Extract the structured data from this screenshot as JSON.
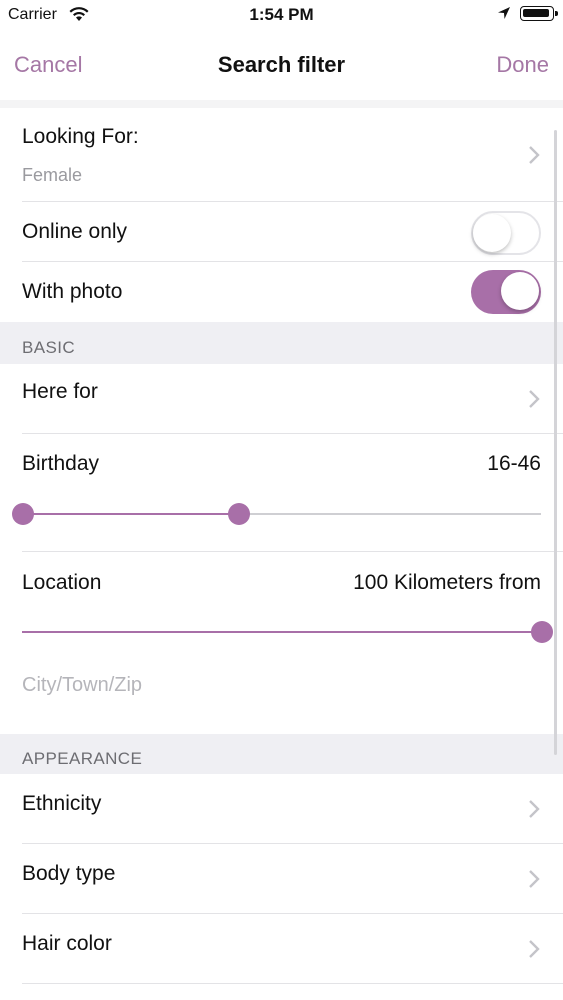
{
  "status_bar": {
    "carrier": "Carrier",
    "time": "1:54 PM",
    "icons": [
      "wifi-icon",
      "location-arrow-icon",
      "battery-icon"
    ]
  },
  "nav": {
    "cancel": "Cancel",
    "title": "Search filter",
    "done": "Done"
  },
  "accent_color": "#a86fa8",
  "looking_for": {
    "label": "Looking For:",
    "value": "Female"
  },
  "online_only": {
    "label": "Online only",
    "on": false
  },
  "with_photo": {
    "label": "With photo",
    "on": true
  },
  "basic": {
    "header": "BASIC",
    "here_for": "Here for",
    "birthday": {
      "label": "Birthday",
      "value": "16-46",
      "min": 16,
      "max": 46
    },
    "location": {
      "label": "Location",
      "value": "100 Kilometers from",
      "fraction": 1.0,
      "placeholder": "City/Town/Zip"
    }
  },
  "appearance": {
    "header": "APPEARANCE",
    "items": [
      "Ethnicity",
      "Body type",
      "Hair color"
    ]
  }
}
